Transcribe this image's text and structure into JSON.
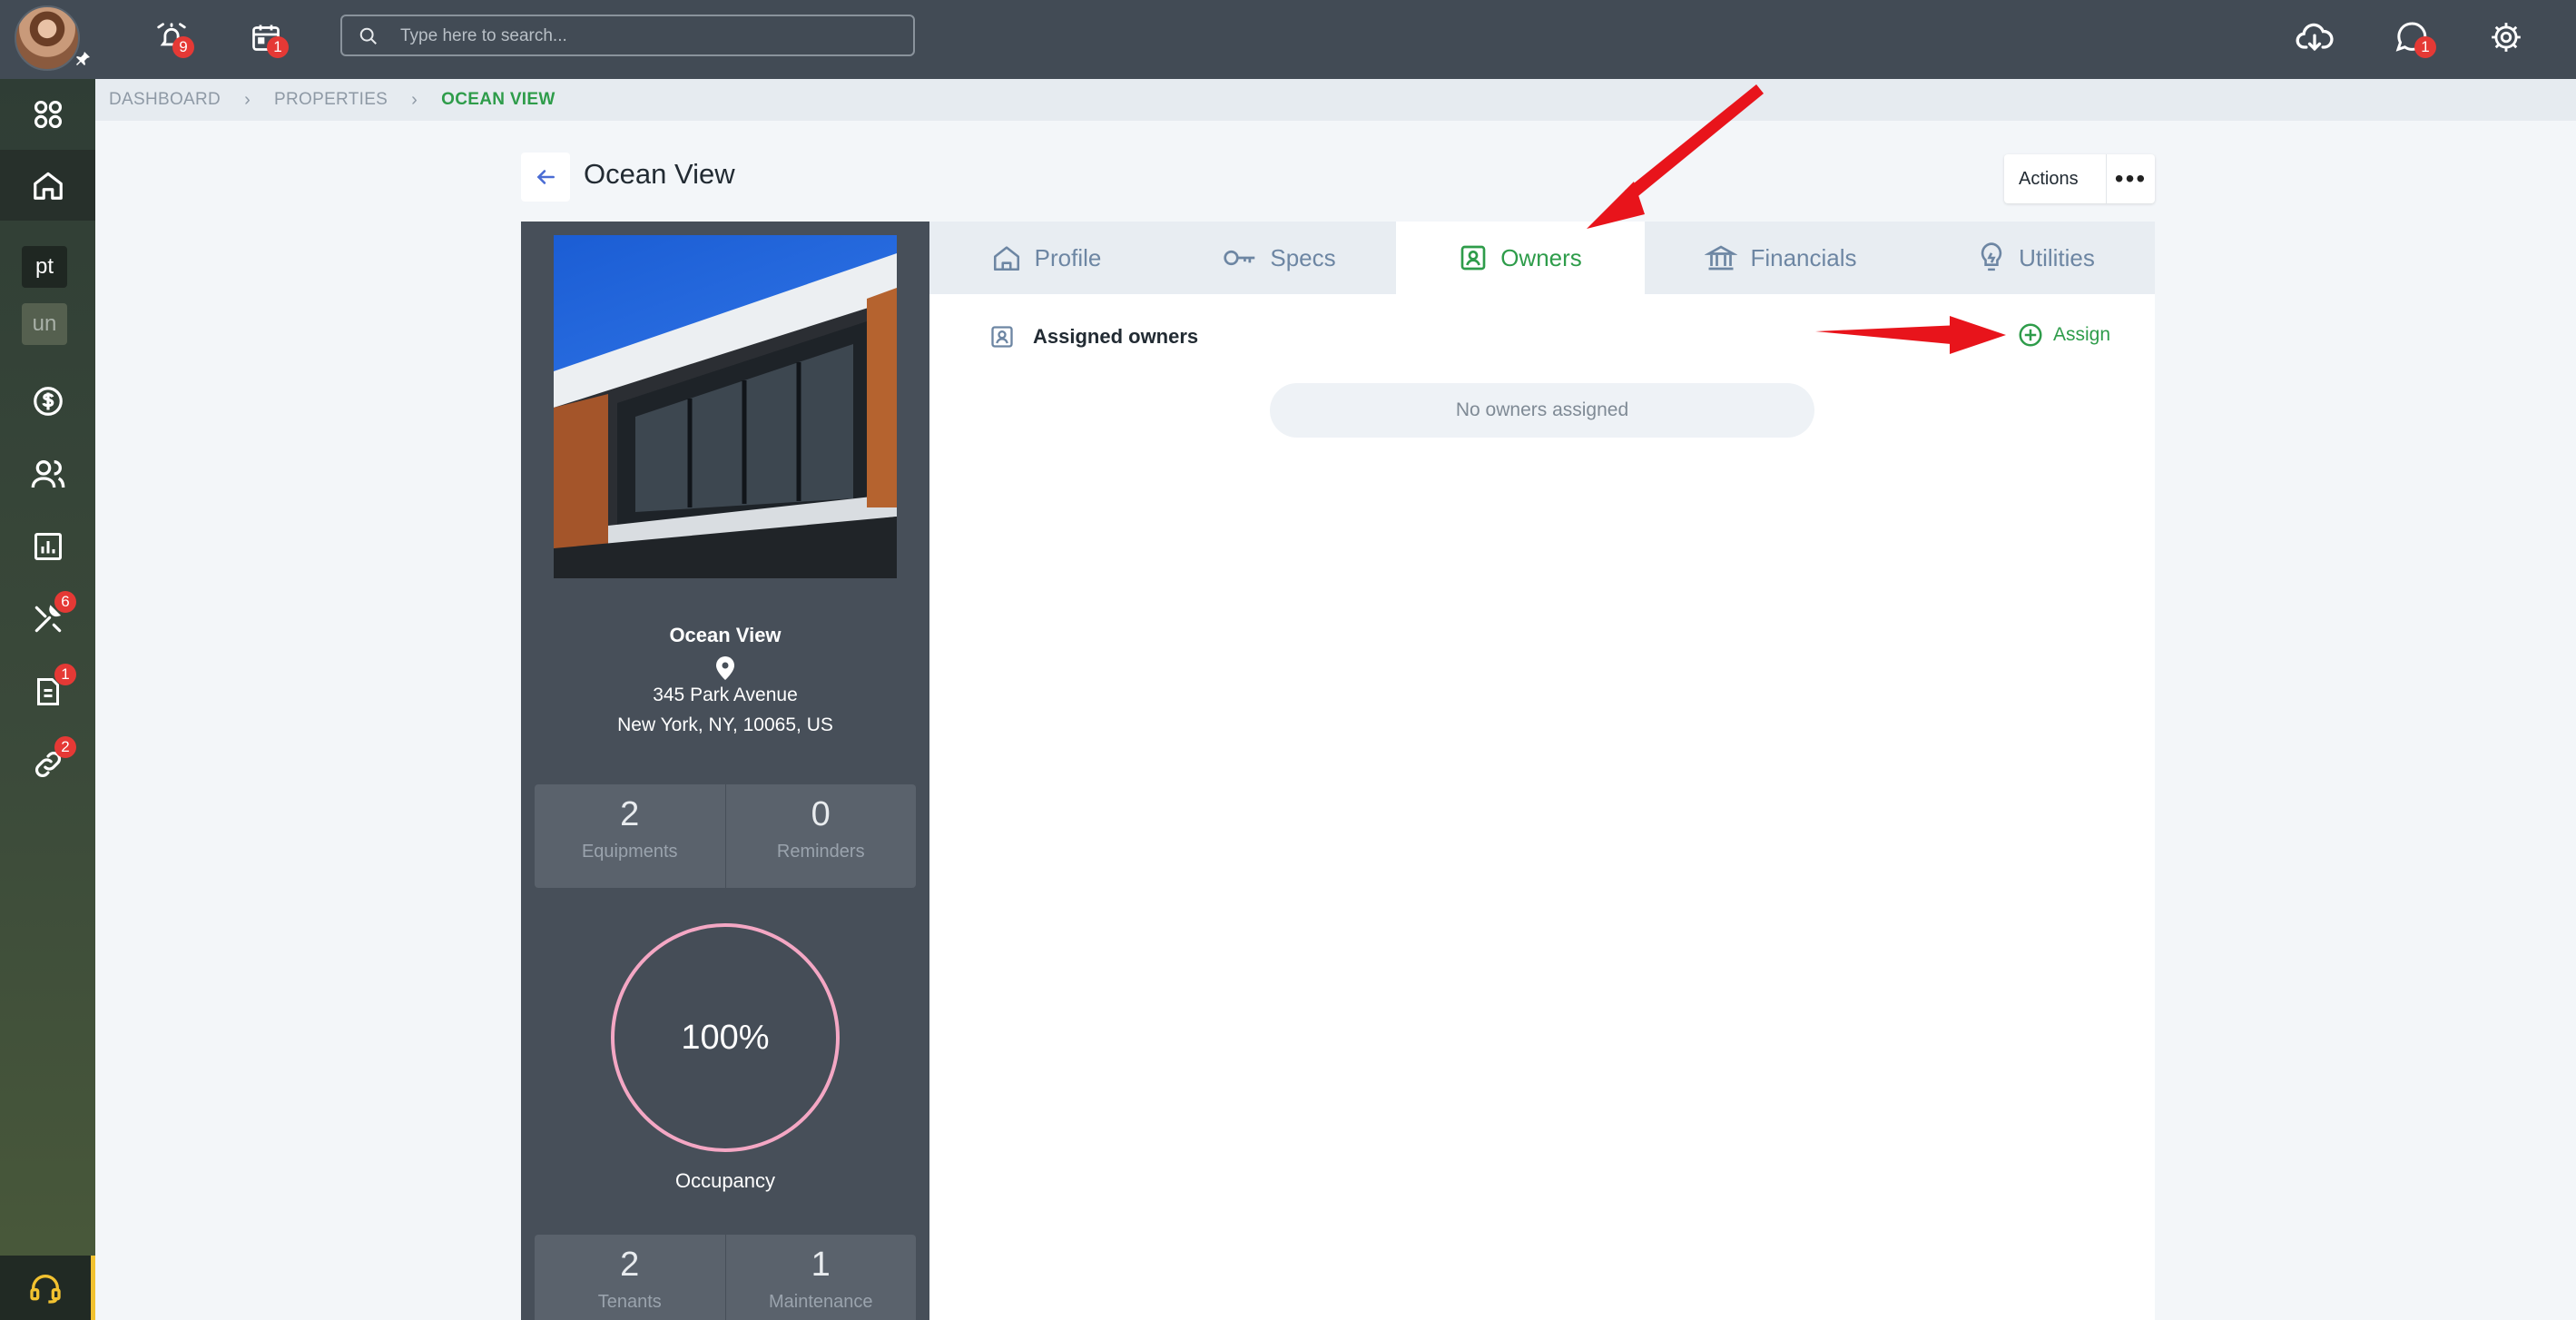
{
  "topbar": {
    "search_placeholder": "Type here to search...",
    "alarm_badge": "9",
    "calendar_badge": "1",
    "messages_badge": "1"
  },
  "sidebar": {
    "chips": [
      "pt",
      "un"
    ],
    "maintenance_badge": "6",
    "documents_badge": "1",
    "links_badge": "2"
  },
  "breadcrumb": [
    "DASHBOARD",
    "PROPERTIES",
    "OCEAN VIEW"
  ],
  "header": {
    "title": "Ocean View",
    "actions_label": "Actions",
    "more": "•••"
  },
  "property": {
    "name": "Ocean View",
    "address_line1": "345 Park Avenue",
    "address_line2": "New York, NY, 10065, US",
    "equipments": "2",
    "equipments_label": "Equipments",
    "reminders": "0",
    "reminders_label": "Reminders",
    "occupancy": "100%",
    "occupancy_value": 1.0,
    "occupancy_label": "Occupancy",
    "tenants": "2",
    "tenants_label": "Tenants",
    "maintenance": "1",
    "maintenance_label": "Maintenance"
  },
  "tabs": [
    {
      "label": "Profile",
      "icon": "house-icon",
      "active": false
    },
    {
      "label": "Specs",
      "icon": "key-icon",
      "active": false
    },
    {
      "label": "Owners",
      "icon": "owner-badge-icon",
      "active": true
    },
    {
      "label": "Financials",
      "icon": "bank-icon",
      "active": false
    },
    {
      "label": "Utilities",
      "icon": "lightbulb-icon",
      "active": false
    }
  ],
  "owners": {
    "section_title": "Assigned owners",
    "assign_label": "Assign",
    "empty_text": "No owners assigned"
  },
  "colors": {
    "accent_green": "#2e9c4a",
    "badge_red": "#e53935",
    "annotation_arrow": "#e8141b",
    "occupancy_ring": "#f4a7c4"
  }
}
